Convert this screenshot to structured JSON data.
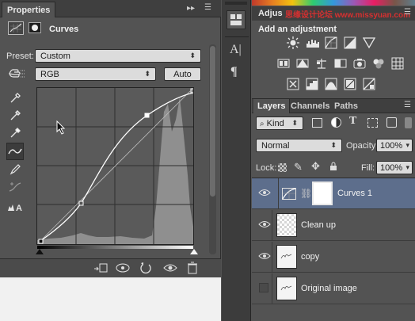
{
  "properties": {
    "tab_label": "Properties",
    "panel_title": "Curves",
    "preset_label": "Preset:",
    "preset_value": "Custom",
    "channel_value": "RGB",
    "auto_label": "Auto"
  },
  "adjustments": {
    "tab_label": "Adjus",
    "add_label": "Add an adjustment"
  },
  "layers": {
    "tabs": [
      "Layers",
      "Channels",
      "Paths"
    ],
    "filter_value": "Kind",
    "blend_mode": "Normal",
    "opacity_label": "Opacity:",
    "opacity_value": "100%",
    "lock_label": "Lock:",
    "fill_label": "Fill:",
    "fill_value": "100%",
    "items": [
      {
        "name": "Curves 1",
        "visible": true
      },
      {
        "name": "Clean up",
        "visible": true
      },
      {
        "name": "copy",
        "visible": true
      },
      {
        "name": "Original image",
        "visible": false
      }
    ]
  },
  "colors": {
    "selected_layer": "#5d6e8c",
    "panel": "#535353",
    "dark_bar": "#3f3f3f"
  }
}
